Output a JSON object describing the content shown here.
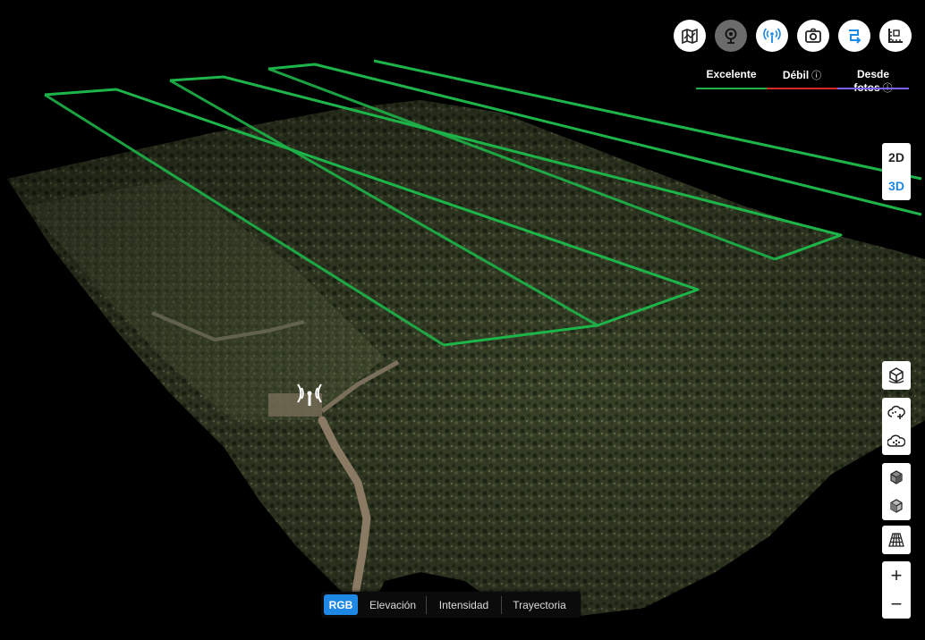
{
  "toolbar": {
    "buttons": [
      {
        "name": "map-layer-button",
        "icon": "map-icon",
        "active": false
      },
      {
        "name": "location-pin-button",
        "icon": "location-pin-icon",
        "active": true
      },
      {
        "name": "signal-antenna-button",
        "icon": "signal-antenna-icon",
        "active": false
      },
      {
        "name": "camera-button",
        "icon": "camera-icon",
        "active": false
      },
      {
        "name": "trajectory-button",
        "icon": "path-arrow-icon",
        "active": false
      },
      {
        "name": "measure-button",
        "icon": "ruler-icon",
        "active": false
      }
    ]
  },
  "legend": {
    "excellent": {
      "label": "Excelente",
      "color": "#1fb14a"
    },
    "weak": {
      "label": "Débil",
      "info": "ⓘ",
      "color": "#d42a2a"
    },
    "from_photos": {
      "label": "Desde fotos",
      "info": "ⓘ",
      "color": "#7b61ff"
    }
  },
  "view_toggle": {
    "option_2d": "2D",
    "option_3d": "3D",
    "selected": "3D"
  },
  "zoom": {
    "in": "+",
    "out": "−"
  },
  "mode_tabs": {
    "rgb": "RGB",
    "elevation": "Elevación",
    "intensity": "Intensidad",
    "trajectory": "Trayectoria",
    "selected": "RGB"
  },
  "colors": {
    "accent": "#1e88e5",
    "flight_line": "#1db449",
    "terrain_dark": "#2a3020",
    "terrain_mid": "#4b5534"
  }
}
